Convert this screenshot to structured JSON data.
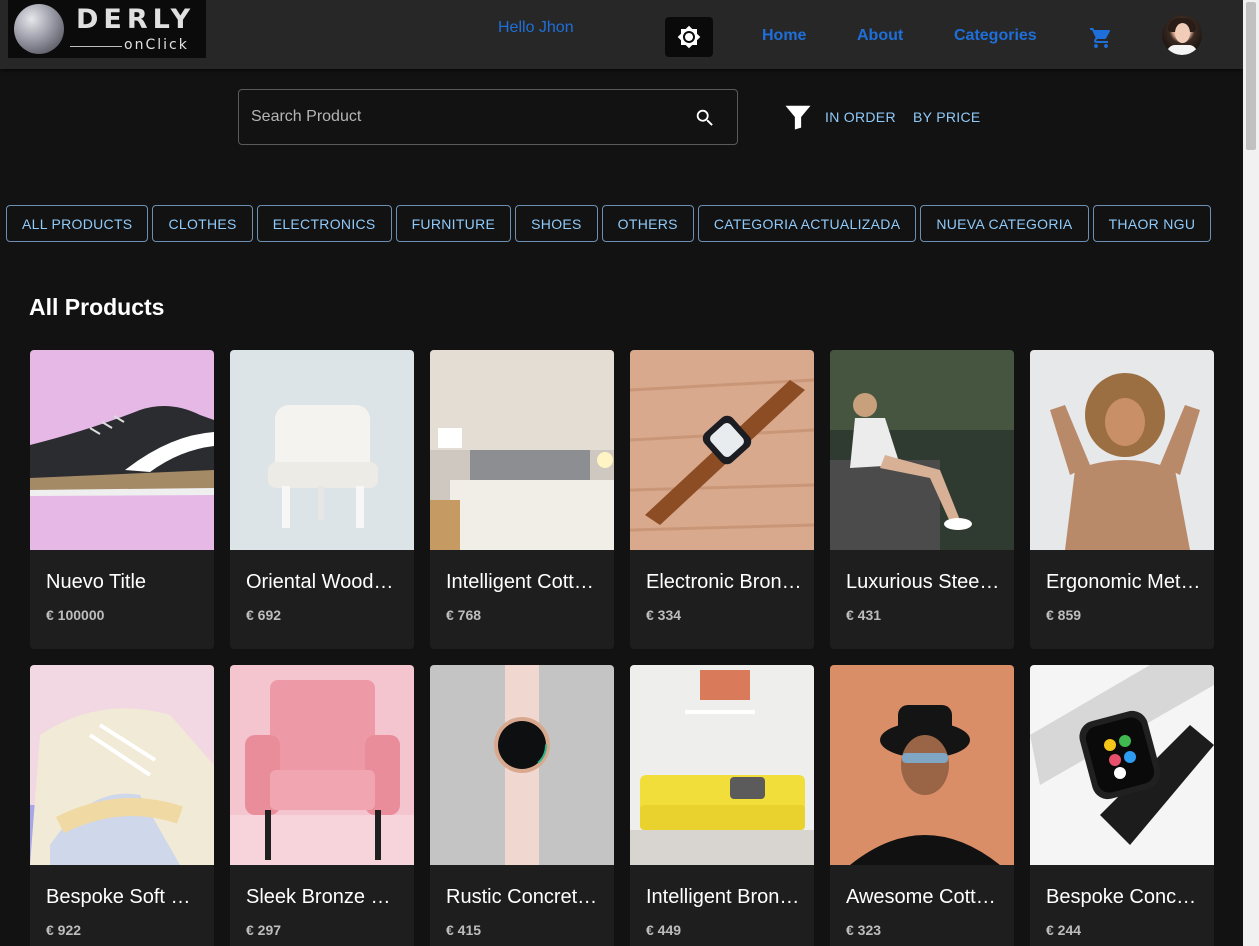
{
  "header": {
    "logo_main": "DERLY",
    "logo_sub": "onClick",
    "greeting": "Hello Jhon",
    "nav": [
      "Home",
      "About",
      "Categories"
    ]
  },
  "search": {
    "placeholder": "Search Product",
    "sort_options": [
      "IN ORDER",
      "BY PRICE"
    ]
  },
  "categories": [
    "ALL PRODUCTS",
    "CLOTHES",
    "ELECTRONICS",
    "FURNITURE",
    "SHOES",
    "OTHERS",
    "CATEGORIA ACTUALIZADA",
    "NUEVA CATEGORIA",
    "THAOR NGU"
  ],
  "section_title": "All Products",
  "products": [
    {
      "title": "Nuevo Title",
      "price": "€ 100000",
      "image": "sneaker-black"
    },
    {
      "title": "Oriental Wooden Chair",
      "price": "€ 692",
      "image": "chair-white"
    },
    {
      "title": "Intelligent Cotton Bed",
      "price": "€ 768",
      "image": "bedroom"
    },
    {
      "title": "Electronic Bronze Watch",
      "price": "€ 334",
      "image": "watch-leather"
    },
    {
      "title": "Luxurious Steel Dress",
      "price": "€ 431",
      "image": "woman-sitting"
    },
    {
      "title": "Ergonomic Metal Sweater",
      "price": "€ 859",
      "image": "woman-curly"
    },
    {
      "title": "Bespoke Soft Shoes",
      "price": "€ 922",
      "image": "sneaker-pastel"
    },
    {
      "title": "Sleek Bronze Chair",
      "price": "€ 297",
      "image": "armchair-pink"
    },
    {
      "title": "Rustic Concrete Watch",
      "price": "€ 415",
      "image": "watch-smart-pink"
    },
    {
      "title": "Intelligent Bronze Sofa",
      "price": "€ 449",
      "image": "sofa-yellow"
    },
    {
      "title": "Awesome Cotton Hat",
      "price": "€ 323",
      "image": "man-hat"
    },
    {
      "title": "Bespoke Concrete Watch",
      "price": "€ 244",
      "image": "watch-apple"
    }
  ],
  "colors": {
    "accent": "#1e6fd9",
    "chip_text": "#90caf9",
    "background": "#121212",
    "appbar": "#272727",
    "card": "#1e1e1e"
  },
  "icons": [
    "brightness-icon",
    "cart-icon",
    "search-icon",
    "filter-icon"
  ]
}
